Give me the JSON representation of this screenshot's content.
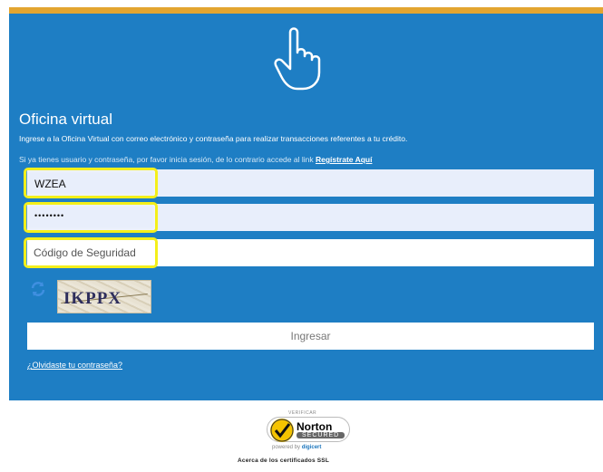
{
  "header": {
    "title": "Oficina virtual",
    "description": "Ingrese a la Oficina Virtual con correo electrónico y contraseña para realizar transacciones referentes a tu crédito.",
    "signin_text": "Si ya tienes usuario y contraseña, por favor inicia sesión, de lo contrario accede al link ",
    "register_link": "Regístrate Aquí"
  },
  "form": {
    "username_value": "WZEA",
    "password_value": "••••••••",
    "security_placeholder": "Código de Seguridad",
    "captcha_text": "IKPPX",
    "submit_label": "Ingresar",
    "forgot_link": "¿Olvidaste tu contraseña?"
  },
  "badge": {
    "verify": "VERIFICAR",
    "brand": "Norton",
    "secured": "SECURED",
    "powered_prefix": "powered by ",
    "powered_brand": "digicert",
    "ssl_text": "Acerca de los certificados SSL"
  },
  "colors": {
    "panel": "#1e7ec4",
    "accent_top": "#e3a530",
    "highlight": "#f4ef1a",
    "field_bg": "#e8eefb"
  },
  "icons": [
    "pointing-hand-icon",
    "refresh-icon",
    "norton-check-icon"
  ]
}
